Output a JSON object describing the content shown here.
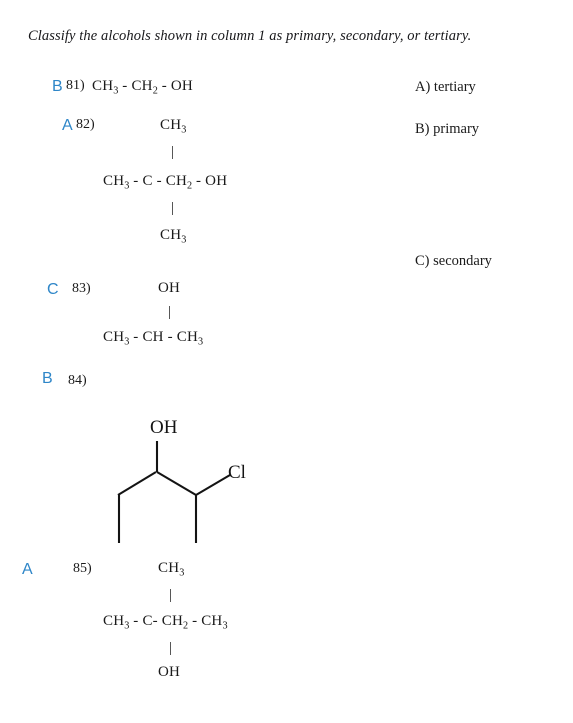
{
  "worksheet": {
    "instruction": "Classify the alcohols shown in column 1 as primary, secondary, or tertiary."
  },
  "questions": [
    {
      "number": "81)",
      "answer_mark": "B",
      "type": "condensed",
      "lines": {
        "top": "",
        "top_bond": "",
        "main": "CH3 - CH2 - OH",
        "bottom_bond": "",
        "bottom": ""
      }
    },
    {
      "number": "82)",
      "answer_mark": "A",
      "type": "condensed",
      "lines": {
        "top": "CH3",
        "top_bond": "|",
        "main": "CH3 - C - CH2 - OH",
        "bottom_bond": "|",
        "bottom": "CH3"
      }
    },
    {
      "number": "83)",
      "answer_mark": "C",
      "type": "condensed",
      "lines": {
        "top": "OH",
        "top_bond": "|",
        "main": "CH3 - CH - CH3",
        "bottom_bond": "",
        "bottom": ""
      }
    },
    {
      "number": "84)",
      "answer_mark": "B",
      "type": "skeletal",
      "labels": {
        "hydroxyl": "OH",
        "halide": "Cl"
      }
    },
    {
      "number": "85)",
      "answer_mark": "A",
      "type": "condensed",
      "lines": {
        "top": "CH3",
        "top_bond": "|",
        "main": "CH3 - C- CH2 - CH3",
        "bottom_bond": "|",
        "bottom": "OH"
      }
    }
  ],
  "options": [
    {
      "label": "A) tertiary"
    },
    {
      "label": "B) primary"
    },
    {
      "label": "C) secondary"
    }
  ],
  "colors": {
    "answer_blue": "#2e86c8",
    "ink": "#141414"
  }
}
